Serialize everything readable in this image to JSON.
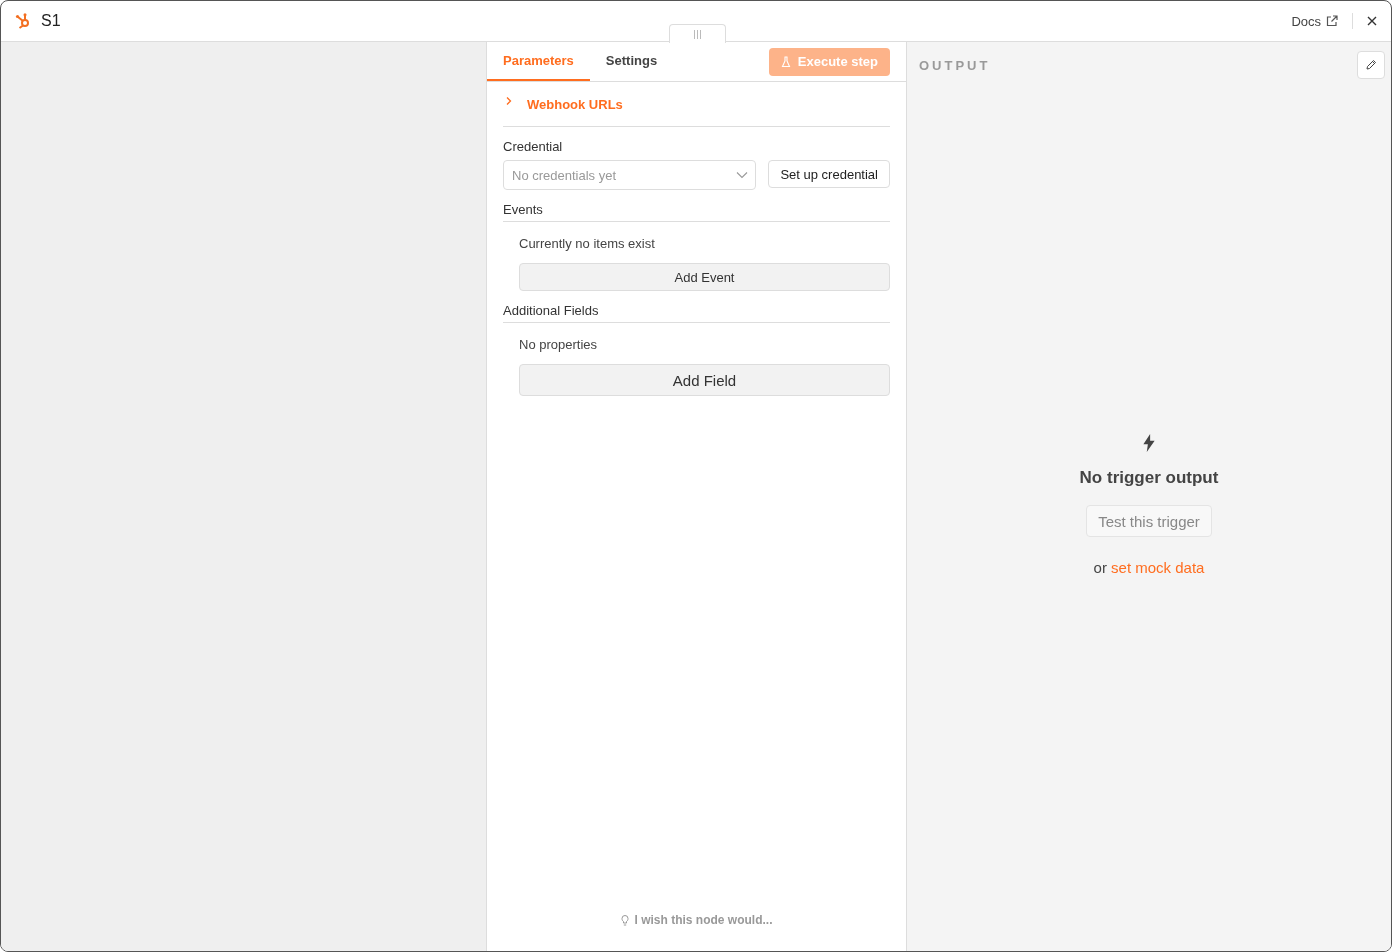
{
  "window": {
    "title": "S1",
    "docs_link": "Docs"
  },
  "tabs": [
    {
      "label": "Parameters",
      "selected": true
    },
    {
      "label": "Settings",
      "selected": false
    }
  ],
  "execute_button": {
    "label": "Execute step",
    "disabled": true
  },
  "webhook_section": {
    "label": "Webhook URLs",
    "expanded": false
  },
  "credential": {
    "label": "Credential",
    "placeholder": "No credentials yet",
    "button": "Set up credential"
  },
  "collections": [
    {
      "title": "Events",
      "empty_text": "Currently no items exist",
      "button": "Add Event",
      "kind": "compact"
    },
    {
      "title": "Additional Fields",
      "empty_text": "No properties",
      "button": "Add Field",
      "kind": "large"
    }
  ],
  "feedback_link": "I wish this node would...",
  "output": {
    "heading": "OUTPUT",
    "empty_title": "No trigger output",
    "test_button": "Test this trigger",
    "mock_prefix": "or",
    "mock_link": "set mock data"
  }
}
